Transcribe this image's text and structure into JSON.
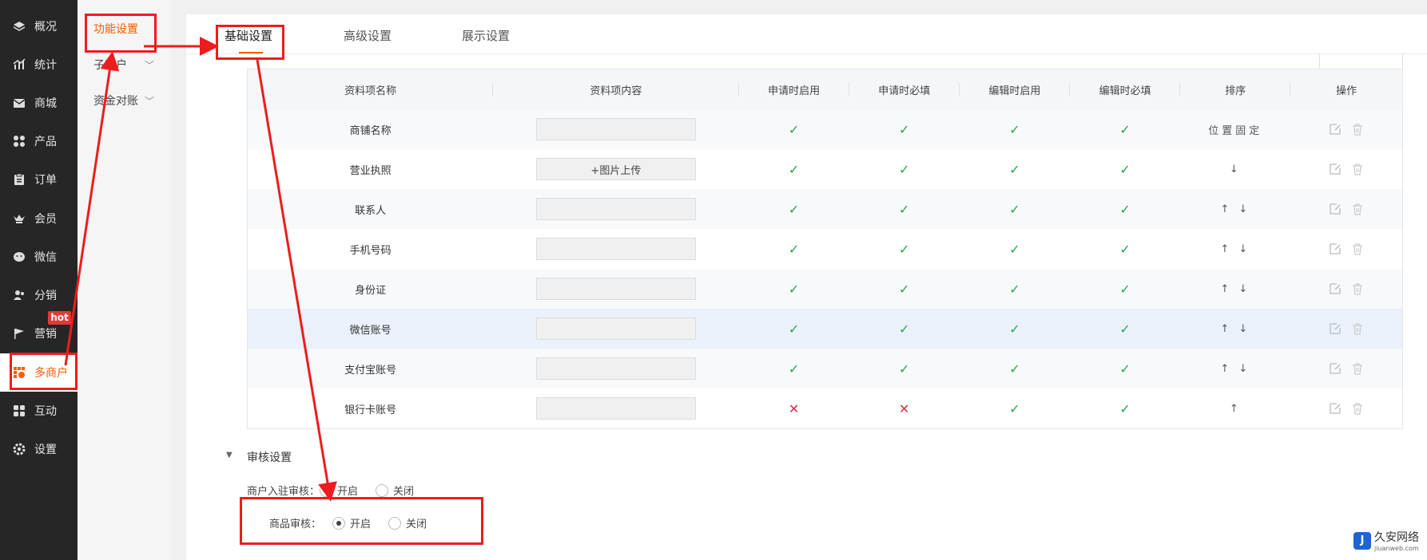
{
  "sidebar": {
    "items": [
      {
        "label": "概况",
        "icon": "layers-icon"
      },
      {
        "label": "统计",
        "icon": "chart-icon"
      },
      {
        "label": "商城",
        "icon": "mail-icon"
      },
      {
        "label": "产品",
        "icon": "grid-icon"
      },
      {
        "label": "订单",
        "icon": "clipboard-icon"
      },
      {
        "label": "会员",
        "icon": "crown-icon"
      },
      {
        "label": "微信",
        "icon": "wechat-icon"
      },
      {
        "label": "分销",
        "icon": "users-icon"
      },
      {
        "label": "营销",
        "icon": "flag-icon"
      },
      {
        "label": "多商户",
        "icon": "store-icon"
      },
      {
        "label": "互动",
        "icon": "apps-icon"
      },
      {
        "label": "设置",
        "icon": "gear-icon"
      }
    ],
    "hot_badge": "hot",
    "active": "多商户"
  },
  "subnav": {
    "items": [
      {
        "label": "功能设置"
      },
      {
        "label": "子商户"
      },
      {
        "label": "资金对账"
      }
    ]
  },
  "tabs": [
    "基础设置",
    "高级设置",
    "展示设置"
  ],
  "table": {
    "headers": [
      "资料项名称",
      "资料项内容",
      "申请时启用",
      "申请时必填",
      "编辑时启用",
      "编辑时必填",
      "排序",
      "操作"
    ],
    "rows": [
      {
        "name": "商铺名称",
        "content": "",
        "apply_enable": "✓",
        "apply_required": "✓",
        "edit_enable": "✓",
        "edit_required": "✓",
        "sort": "位置固定"
      },
      {
        "name": "营业执照",
        "content": "+图片上传",
        "apply_enable": "✓",
        "apply_required": "✓",
        "edit_enable": "✓",
        "edit_required": "✓",
        "sort": "↓"
      },
      {
        "name": "联系人",
        "content": "",
        "apply_enable": "✓",
        "apply_required": "✓",
        "edit_enable": "✓",
        "edit_required": "✓",
        "sort": "↑ ↓"
      },
      {
        "name": "手机号码",
        "content": "",
        "apply_enable": "✓",
        "apply_required": "✓",
        "edit_enable": "✓",
        "edit_required": "✓",
        "sort": "↑ ↓"
      },
      {
        "name": "身份证",
        "content": "",
        "apply_enable": "✓",
        "apply_required": "✓",
        "edit_enable": "✓",
        "edit_required": "✓",
        "sort": "↑ ↓"
      },
      {
        "name": "微信账号",
        "content": "",
        "apply_enable": "✓",
        "apply_required": "✓",
        "edit_enable": "✓",
        "edit_required": "✓",
        "sort": "↑ ↓"
      },
      {
        "name": "支付宝账号",
        "content": "",
        "apply_enable": "✓",
        "apply_required": "✓",
        "edit_enable": "✓",
        "edit_required": "✓",
        "sort": "↑ ↓"
      },
      {
        "name": "银行卡账号",
        "content": "",
        "apply_enable": "✕",
        "apply_required": "✕",
        "edit_enable": "✓",
        "edit_required": "✓",
        "sort": "↑"
      }
    ]
  },
  "review": {
    "title": "审核设置",
    "merchant_label": "商户入驻审核：",
    "goods_label": "商品审核：",
    "on": "开启",
    "off": "关闭",
    "merchant_value": "开启",
    "goods_value": "开启"
  },
  "watermark": {
    "title": "久安网络",
    "sub": "jiuanweb.com",
    "logo": "J"
  },
  "colors": {
    "accent": "#ff5a00",
    "annotation": "#ee1c1c",
    "check": "#2aa64a",
    "cross": "#e0284f"
  }
}
